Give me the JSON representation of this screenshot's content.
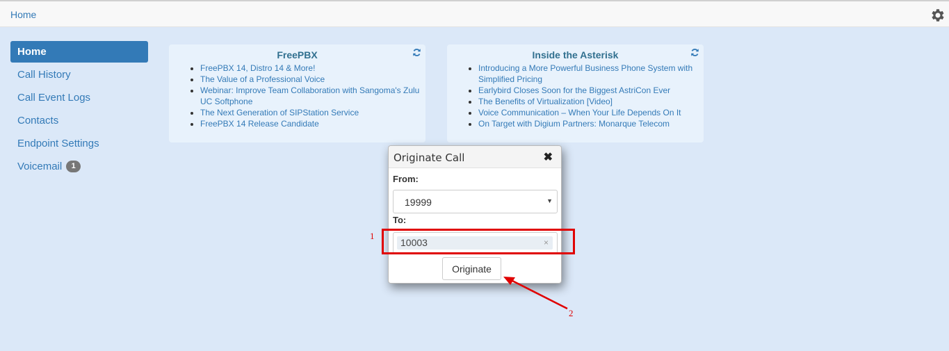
{
  "topbar": {
    "breadcrumb": "Home",
    "settings_icon": "gear-icon"
  },
  "sidebar": {
    "items": [
      {
        "label": "Home",
        "active": true
      },
      {
        "label": "Call History"
      },
      {
        "label": "Call Event Logs"
      },
      {
        "label": "Contacts"
      },
      {
        "label": "Endpoint Settings"
      },
      {
        "label": "Voicemail",
        "badge": "1"
      }
    ]
  },
  "feeds": [
    {
      "title": "FreePBX",
      "refresh_icon": "refresh-icon",
      "items": [
        "FreePBX 14, Distro 14 & More!",
        "The Value of a Professional Voice",
        "Webinar: Improve Team Collaboration with Sangoma's Zulu UC Softphone",
        "The Next Generation of SIPStation Service",
        "FreePBX 14 Release Candidate"
      ]
    },
    {
      "title": "Inside the Asterisk",
      "refresh_icon": "refresh-icon",
      "items": [
        "Introducing a More Powerful Business Phone System with Simplified Pricing",
        "Earlybird Closes Soon for the Biggest AstriCon Ever",
        "The Benefits of Virtualization [Video]",
        "Voice Communication – When Your Life Depends On It",
        "On Target with Digium Partners: Monarque Telecom"
      ]
    }
  ],
  "modal": {
    "title": "Originate Call",
    "close_glyph": "✖",
    "from_label": "From:",
    "from_value": "19999",
    "to_label": "To:",
    "to_value": "10003",
    "tag_remove_glyph": "×",
    "submit_label": "Originate"
  },
  "annotations": {
    "label_1": "1",
    "label_2": "2",
    "color": "#e00000"
  },
  "colors": {
    "link": "#337ab7",
    "background": "#dbe8f8",
    "feed_title": "#31708f"
  }
}
